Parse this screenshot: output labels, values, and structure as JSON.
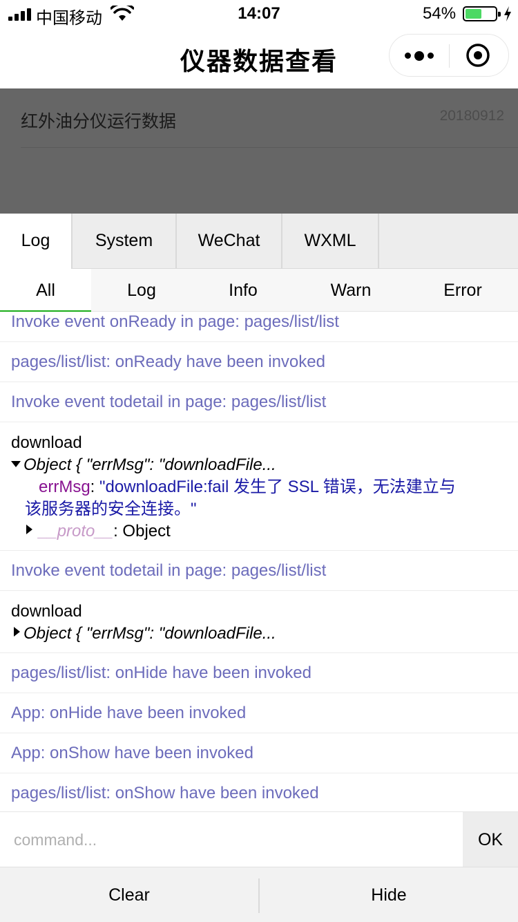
{
  "status_bar": {
    "carrier": "中国移动",
    "time": "14:07",
    "battery_percent": "54%",
    "battery_level": 0.54,
    "icons": [
      "signal-icon",
      "wifi-icon",
      "battery-icon",
      "charging-icon"
    ]
  },
  "nav": {
    "title": "仪器数据查看",
    "icons": [
      "more-dots-icon",
      "target-circle-icon"
    ]
  },
  "page": {
    "record_title": "红外油分仪运行数据",
    "record_date": "20180912"
  },
  "console": {
    "tabs": [
      "Log",
      "System",
      "WeChat",
      "WXML"
    ],
    "active_tab": "Log",
    "subtabs": [
      "All",
      "Log",
      "Info",
      "Warn",
      "Error"
    ],
    "active_subtab": "All",
    "logs": [
      "Invoke event onReady in page: pages/list/list",
      "pages/list/list: onReady have been invoked",
      "Invoke event todetail in page: pages/list/list"
    ],
    "download1": {
      "label": "download",
      "object_summary": "Object { \"errMsg\": \"downloadFile...",
      "key": "errMsg",
      "colon": ": ",
      "value_line1": "\"downloadFile:fail 发生了 SSL 错误，无法建立与",
      "value_line2": "该服务器的安全连接。\"",
      "proto_key": "__proto__",
      "proto_value": ": Object"
    },
    "log_after_download1": "Invoke event todetail in page: pages/list/list",
    "download2": {
      "label": "download",
      "object_summary": "Object { \"errMsg\": \"downloadFile..."
    },
    "logs_after": [
      "pages/list/list: onHide have been invoked",
      "App: onHide have been invoked",
      "App: onShow have been invoked",
      "pages/list/list: onShow have been invoked"
    ],
    "command_placeholder": "command...",
    "ok_label": "OK",
    "clear_label": "Clear",
    "hide_label": "Hide",
    "colors": {
      "system_log": "#6c6cbb",
      "key": "#881391",
      "string": "#1a1aa6",
      "active_underline": "#1aad19",
      "overlay": "#666666"
    }
  }
}
